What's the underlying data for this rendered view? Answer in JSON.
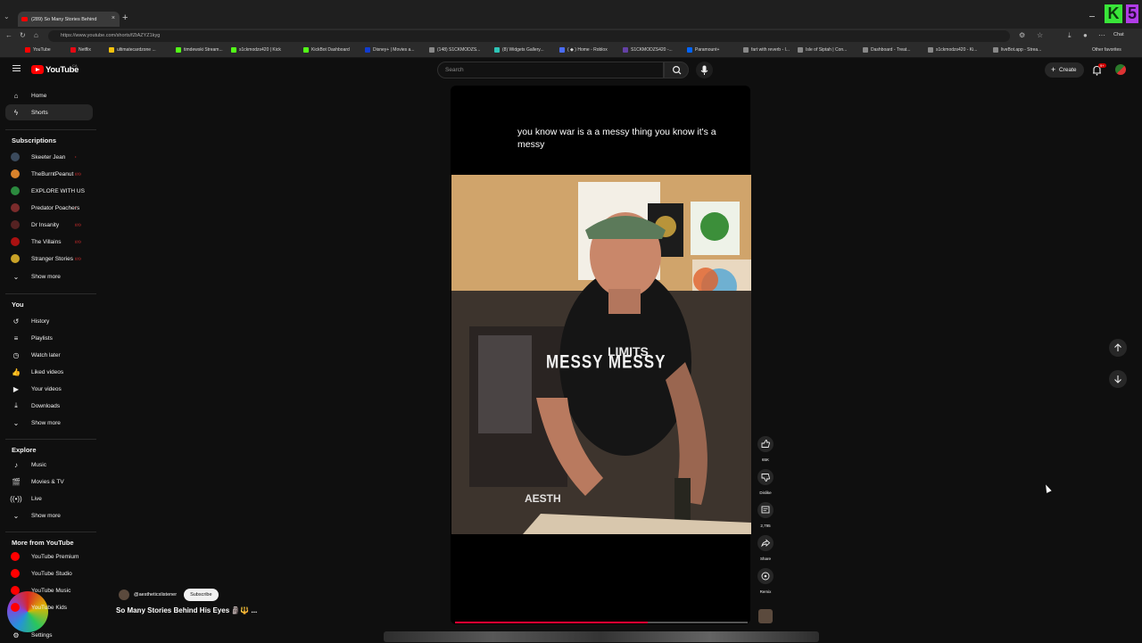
{
  "browser": {
    "tab_title": "(289) So Many Stories Behind",
    "tab_close": "×",
    "new_tab": "+",
    "url": "https://www.youtube.com/shorts/fZtAZYZ1kyg",
    "chat_label": "Chat",
    "other_favorites": "Other favorites",
    "bookmarks": [
      {
        "label": "YouTube",
        "color": "#ff0000"
      },
      {
        "label": "Netflix",
        "color": "#e50914"
      },
      {
        "label": "ultimatecardzone ...",
        "color": "#f4c20d"
      },
      {
        "label": "timdewski Stream...",
        "color": "#53fc18"
      },
      {
        "label": "s1ckmodzs420 | Kick",
        "color": "#53fc18"
      },
      {
        "label": "KickBot Dashboard",
        "color": "#53fc18"
      },
      {
        "label": "Disney+ | Movies a...",
        "color": "#113ccf"
      },
      {
        "label": "(148) S1CKMODZS...",
        "color": "#888888"
      },
      {
        "label": "(8) Widgets Gallery...",
        "color": "#2ec4b6"
      },
      {
        "label": "( ◆ ) Home - Roblox",
        "color": "#4a6cf7"
      },
      {
        "label": "S1CKMODZS420 -...",
        "color": "#6441a5"
      },
      {
        "label": "Paramount+",
        "color": "#0064ff"
      },
      {
        "label": "fart with reverb - I...",
        "color": "#888888"
      },
      {
        "label": "Isle of Siptah | Con...",
        "color": "#888888"
      },
      {
        "label": "Dashboard - Treat...",
        "color": "#888888"
      },
      {
        "label": "s1ckmodzs420 - Ki...",
        "color": "#888888"
      },
      {
        "label": "liveBot.app - Strea...",
        "color": "#888888"
      }
    ]
  },
  "header": {
    "brand": "YouTube",
    "country": "CA",
    "search_placeholder": "Search",
    "create_label": "Create",
    "notif_badge": "9+"
  },
  "sidebar": {
    "main": [
      {
        "label": "Home",
        "icon": "home-icon",
        "glyph": "⌂"
      },
      {
        "label": "Shorts",
        "icon": "shorts-icon",
        "glyph": "ϟ"
      }
    ],
    "subscriptions_heading": "Subscriptions",
    "subscriptions": [
      {
        "label": "Skeeter Jean",
        "color": "#3b4a5c",
        "live": "•"
      },
      {
        "label": "TheBurntPeanut",
        "color": "#d9822b",
        "live": "((•))"
      },
      {
        "label": "EXPLORE WITH US",
        "color": "#2b8a3e",
        "live": ""
      },
      {
        "label": "Predator Poachers",
        "color": "#7a2b2b",
        "live": "•"
      },
      {
        "label": "Dr Insanity",
        "color": "#552222",
        "live": "((•))"
      },
      {
        "label": "The Villains",
        "color": "#aa1111",
        "live": "((•))"
      },
      {
        "label": "Stranger Stories",
        "color": "#c9a227",
        "live": "((•))"
      }
    ],
    "subs_show_more": "Show more",
    "you_heading": "You",
    "you": [
      {
        "label": "History",
        "icon": "history-icon",
        "glyph": "↺"
      },
      {
        "label": "Playlists",
        "icon": "playlists-icon",
        "glyph": "≡"
      },
      {
        "label": "Watch later",
        "icon": "watch-later-icon",
        "glyph": "◷"
      },
      {
        "label": "Liked videos",
        "icon": "like-icon",
        "glyph": "👍"
      },
      {
        "label": "Your videos",
        "icon": "your-videos-icon",
        "glyph": "▶"
      },
      {
        "label": "Downloads",
        "icon": "download-icon",
        "glyph": "⤓"
      }
    ],
    "you_show_more": "Show more",
    "explore_heading": "Explore",
    "explore": [
      {
        "label": "Music",
        "icon": "music-icon",
        "glyph": "♪"
      },
      {
        "label": "Movies & TV",
        "icon": "movies-icon",
        "glyph": "🎬"
      },
      {
        "label": "Live",
        "icon": "live-icon",
        "glyph": "((•))"
      }
    ],
    "explore_show_more": "Show more",
    "more_heading": "More from YouTube",
    "more": [
      {
        "label": "YouTube Premium",
        "color": "#ff0000"
      },
      {
        "label": "YouTube Studio",
        "color": "#ff0000"
      },
      {
        "label": "YouTube Music",
        "color": "#ff0000"
      },
      {
        "label": "YouTube Kids",
        "color": "#ff0000"
      }
    ],
    "settings": "Settings"
  },
  "short": {
    "caption": "you know war is a a messy thing you know it's a messy",
    "overlay_text": "MESSY MESSY",
    "shirt_text": "LIMITS",
    "watermark": "AESTH",
    "likes": "65K",
    "dislike_label": "Dislike",
    "comments": "2,795",
    "share_label": "Share",
    "remix_label": "Remix",
    "progress": 0.66,
    "channel": "@aestheticxlistener",
    "subscribe_label": "Subscribe",
    "title": "So Many Stories Behind His Eyes 🗿🔱 ..."
  }
}
